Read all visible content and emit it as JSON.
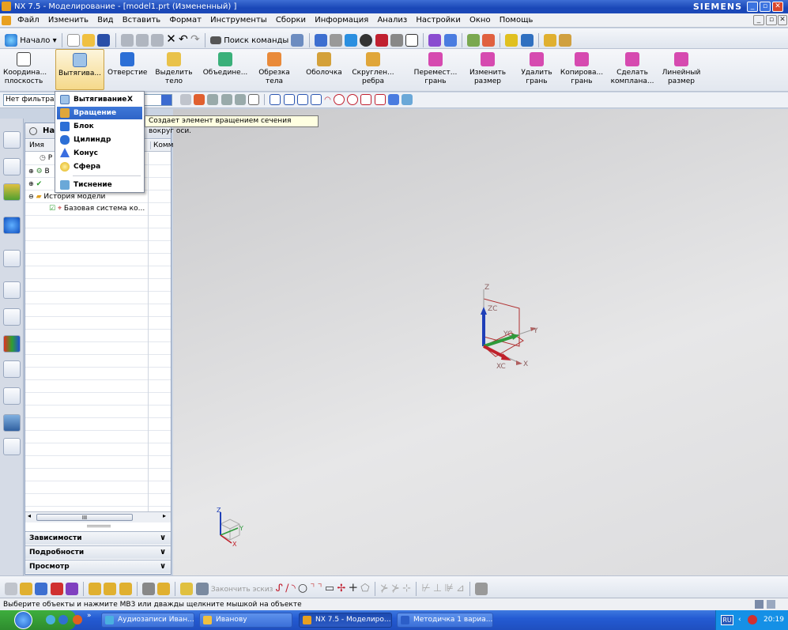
{
  "window": {
    "title": "NX 7.5 - Моделирование - [model1.prt (Измененный) ]",
    "brand": "SIEMENS",
    "controls": [
      "_",
      "▫",
      "✕"
    ]
  },
  "menubar": {
    "items": [
      "Файл",
      "Изменить",
      "Вид",
      "Вставить",
      "Формат",
      "Инструменты",
      "Сборки",
      "Информация",
      "Анализ",
      "Настройки",
      "Окно",
      "Помощь"
    ]
  },
  "toolbar_top": {
    "start_label": "Начало",
    "command_search_label": "Поиск команды"
  },
  "feature_toolbar": {
    "buttons": [
      {
        "label_1": "Координа...",
        "label_2": "плоскость",
        "icon": "datum-plane-icon",
        "color": "#ffffff"
      },
      {
        "label_1": "Вытягива...",
        "label_2": "",
        "icon": "extrude-icon",
        "color": "#9fc3e8"
      },
      {
        "label_1": "Отверстие",
        "label_2": "",
        "icon": "hole-icon",
        "color": "#2c6fd6"
      },
      {
        "label_1": "Выделить",
        "label_2": "тело",
        "icon": "extract-body-icon",
        "color": "#e9c24a"
      },
      {
        "label_1": "Объедине...",
        "label_2": "",
        "icon": "unite-icon",
        "color": "#3ab07a"
      },
      {
        "label_1": "Обрезка",
        "label_2": "тела",
        "icon": "trim-body-icon",
        "color": "#e98a3a"
      },
      {
        "label_1": "Оболочка",
        "label_2": "",
        "icon": "shell-icon",
        "color": "#d4a13a"
      },
      {
        "label_1": "Скруглен...",
        "label_2": "ребра",
        "icon": "edge-blend-icon",
        "color": "#e0a63a"
      },
      {
        "label_1": "Перемест...",
        "label_2": "грань",
        "icon": "move-face-icon",
        "color": "#d64ab0"
      },
      {
        "label_1": "Изменить",
        "label_2": "размер",
        "icon": "resize-face-icon",
        "color": "#d64ab0"
      },
      {
        "label_1": "Удалить",
        "label_2": "грань",
        "icon": "delete-face-icon",
        "color": "#d64ab0"
      },
      {
        "label_1": "Копирова...",
        "label_2": "грань",
        "icon": "copy-face-icon",
        "color": "#d64ab0"
      },
      {
        "label_1": "Сделать",
        "label_2": "компланa...",
        "icon": "make-coplanar-icon",
        "color": "#d64ab0"
      },
      {
        "label_1": "Линейный",
        "label_2": "размер",
        "icon": "linear-dimension-icon",
        "color": "#d64ab0"
      }
    ]
  },
  "filter": {
    "value": "Нет фильтра в"
  },
  "dropdown_menu": {
    "items": [
      {
        "label": "Вытягивание",
        "shortcut": "X",
        "icon": "extrude-icon",
        "color": "#9fc3e8",
        "selected": false
      },
      {
        "label": "Вращение",
        "shortcut": "",
        "icon": "revolve-icon",
        "color": "#e0a63a",
        "selected": true
      },
      {
        "label": "Блок",
        "shortcut": "",
        "icon": "block-icon",
        "color": "#2c6fd6",
        "selected": false
      },
      {
        "label": "Цилиндр",
        "shortcut": "",
        "icon": "cylinder-icon",
        "color": "#2c6fd6",
        "selected": false
      },
      {
        "label": "Конус",
        "shortcut": "",
        "icon": "cone-icon",
        "color": "#3a6ee0",
        "selected": false
      },
      {
        "label": "Сфера",
        "shortcut": "",
        "icon": "sphere-icon",
        "color": "#f0c020",
        "selected": false
      },
      {
        "label": "Тиснение",
        "shortcut": "",
        "icon": "emboss-icon",
        "color": "#6aa8d8",
        "selected": false
      }
    ]
  },
  "tooltip": {
    "text": "Создает элемент вращением сечения вокруг оси."
  },
  "navigator": {
    "title": "На",
    "col_name": "Имя",
    "col_comment": "Комм",
    "rows": [
      {
        "label": "Р",
        "indent": 1,
        "icon": "history-clock-icon"
      },
      {
        "label": "В",
        "indent": 0,
        "icon": "assembly-icon"
      },
      {
        "label": "",
        "indent": 0,
        "icon": "check-icon"
      },
      {
        "label": "История модели",
        "indent": 0,
        "icon": "folder-icon"
      },
      {
        "label": "Базовая система ко...",
        "indent": 2,
        "icon": "datum-csys-icon"
      }
    ],
    "accordion": [
      "Зависимости",
      "Подробности",
      "Просмотр"
    ],
    "scroll_thumb": "III"
  },
  "viewport": {
    "triad_labels": {
      "z": "Z",
      "zc": "ZC",
      "yc": "YC",
      "y": "Y",
      "xc": "XC",
      "x": "X"
    },
    "mini_triad_labels": {
      "z": "Z",
      "y": "Y",
      "x": "X"
    },
    "colors": {
      "z_axis": "#1f3fb8",
      "y_axis": "#2e9a3a",
      "x_axis": "#c0202a",
      "plane": "#b03030"
    }
  },
  "sketch_toolbar": {
    "finish_sketch_label": "Закончить эскиз"
  },
  "status_bar": {
    "text": "Выберите объекты и нажмите МВ3 или дважды щелкните мышкой на объекте"
  },
  "taskbar": {
    "tasks": [
      {
        "label": "Аудиозаписи Иван...",
        "active": false,
        "color": "#4ab0e0"
      },
      {
        "label": "Иванову",
        "active": false,
        "color": "#f0c040"
      },
      {
        "label": "NX 7.5 - Моделиро...",
        "active": true,
        "color": "#e8a020"
      },
      {
        "label": "Методичка 1 вариа...",
        "active": false,
        "color": "#2c5ec8"
      }
    ],
    "lang": "RU",
    "clock": "20:19"
  }
}
